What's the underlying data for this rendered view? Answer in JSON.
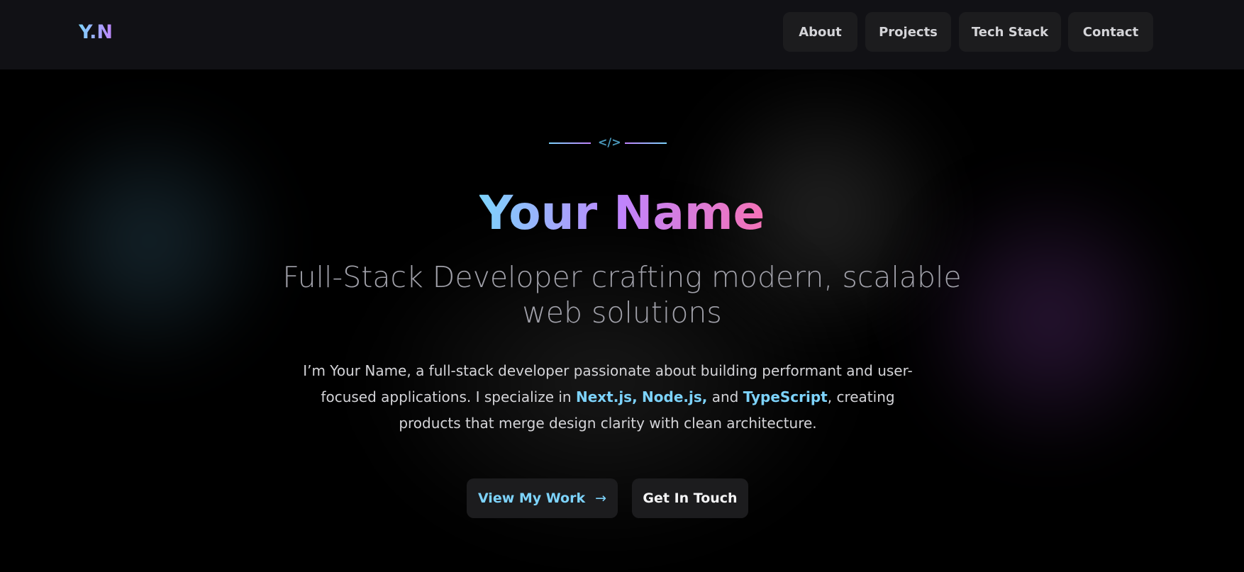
{
  "header": {
    "logo_y": "Y",
    "logo_dot": ".",
    "logo_n": "N",
    "nav": [
      "About",
      "Projects",
      "Tech Stack",
      "Contact"
    ]
  },
  "hero": {
    "divider_icon": "code-icon",
    "divider_text": "</>",
    "title": "Your Name",
    "subtitle": "Full-Stack Developer crafting modern, scalable web solutions",
    "intro_1": "I’m Your Name, a full-stack developer passionate about building performant and user-focused applications. I specialize in ",
    "tech_1": "Next.js,",
    "tech_2": "Node.js,",
    "and": " and ",
    "tech_3": "TypeScript",
    "intro_2": ", creating products that merge design clarity with clean architecture.",
    "primary_button": "View My Work",
    "primary_icon": "arrow-right-icon",
    "arrow": "→",
    "secondary_button": "Get In Touch"
  },
  "colors": {
    "accent_blue": "#7dd3fc",
    "accent_purple": "#c084fc",
    "accent_pink": "#f472b6",
    "background": "#000000",
    "header": "#111115"
  }
}
